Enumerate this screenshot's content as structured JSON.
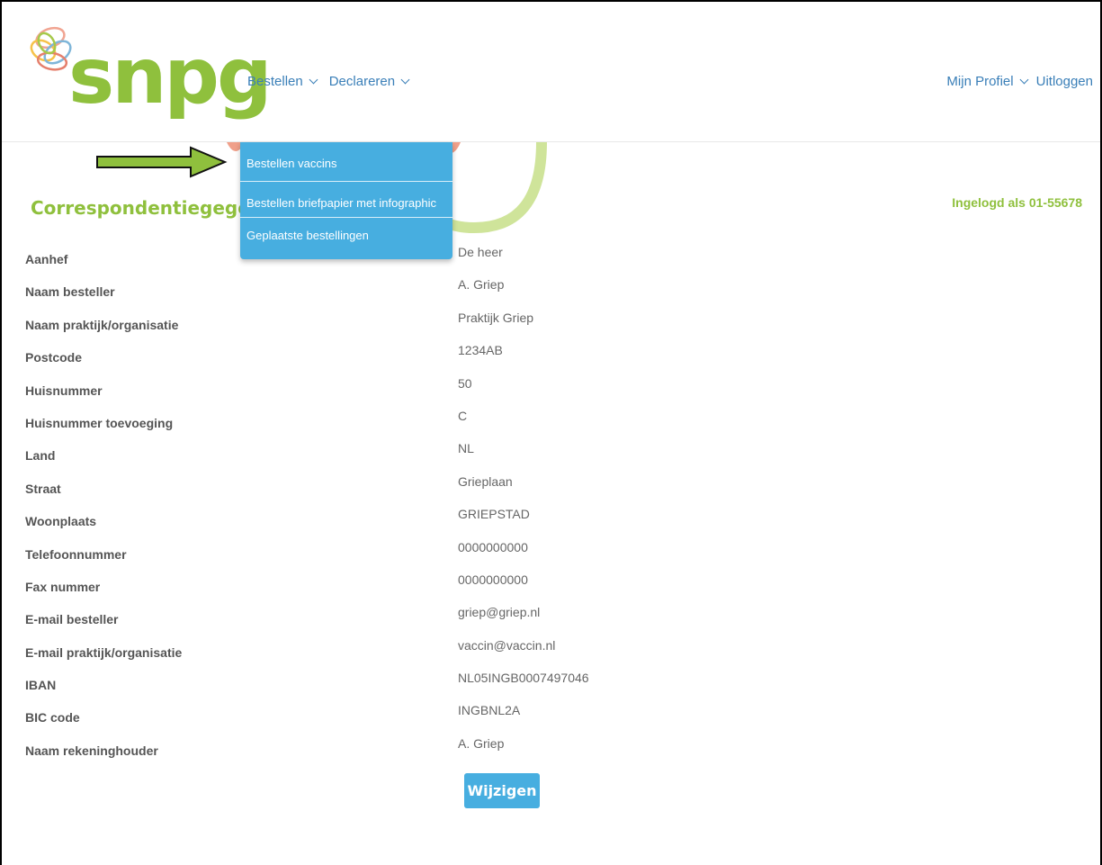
{
  "brand": {
    "logo_text": "snpg",
    "green": "#8fc03d",
    "blue": "#47aee0",
    "link": "#3a7fb8"
  },
  "nav": {
    "bestellen": "Bestellen",
    "declareren": "Declareren",
    "profile": "Mijn Profiel",
    "logout": "Uitloggen"
  },
  "dropdown": {
    "items": [
      "Bestellen vaccins",
      "Bestellen briefpapier met infographic",
      "Geplaatste bestellingen"
    ]
  },
  "page": {
    "title": "Correspondentiegegevens",
    "logged_in": "Ingelogd als 01-55678"
  },
  "fields": [
    {
      "label": "Aanhef",
      "value": "De heer"
    },
    {
      "label": "Naam besteller",
      "value": "A. Griep"
    },
    {
      "label": "Naam praktijk/organisatie",
      "value": "Praktijk Griep"
    },
    {
      "label": "Postcode",
      "value": "1234AB"
    },
    {
      "label": "Huisnummer",
      "value": "50"
    },
    {
      "label": "Huisnummer toevoeging",
      "value": "C"
    },
    {
      "label": "Land",
      "value": "NL"
    },
    {
      "label": "Straat",
      "value": "Grieplaan"
    },
    {
      "label": "Woonplaats",
      "value": "GRIEPSTAD"
    },
    {
      "label": "Telefoonnummer",
      "value": "0000000000"
    },
    {
      "label": "Fax nummer",
      "value": "0000000000"
    },
    {
      "label": "E-mail besteller",
      "value": "griep@griep.nl"
    },
    {
      "label": "E-mail praktijk/organisatie",
      "value": "vaccin@vaccin.nl"
    },
    {
      "label": "IBAN",
      "value": "NL05INGB0007497046"
    },
    {
      "label": "BIC code",
      "value": "INGBNL2A"
    },
    {
      "label": "Naam rekeninghouder",
      "value": "A. Griep"
    }
  ],
  "actions": {
    "edit_label": "Wijzigen"
  }
}
